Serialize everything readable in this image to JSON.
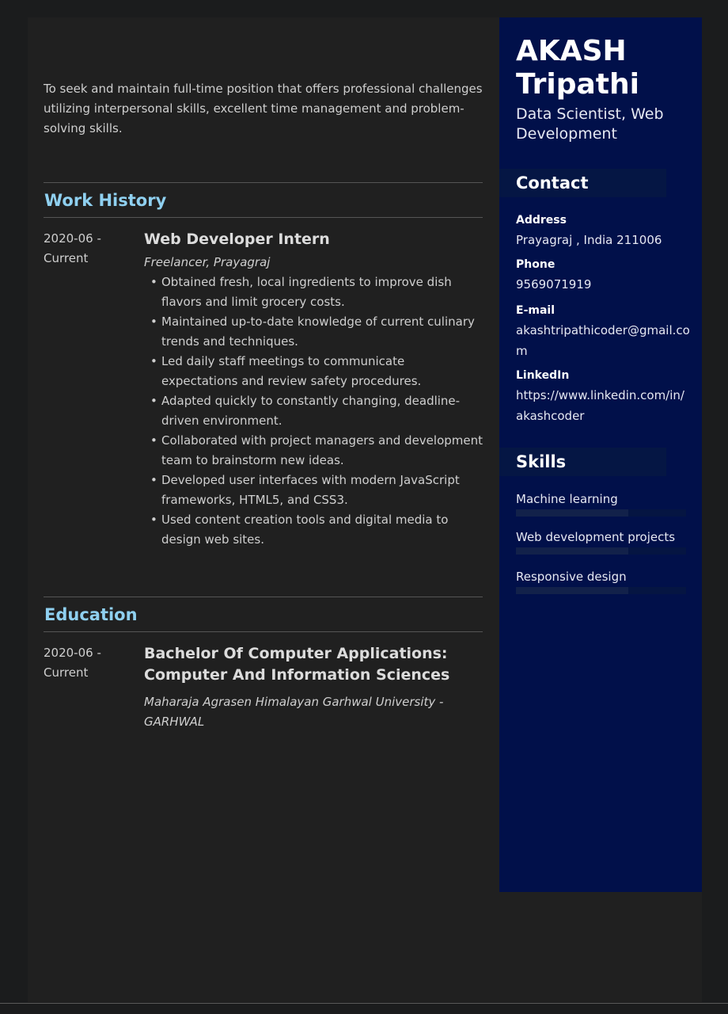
{
  "summary": "To seek and maintain full-time position that offers professional challenges utilizing interpersonal skills, excellent time management and problem-solving skills.",
  "work_history": {
    "heading": "Work History",
    "entries": [
      {
        "date_start": "2020-06 -",
        "date_end": "Current",
        "title": "Web Developer Intern",
        "company": "Freelancer, Prayagraj",
        "bullets": [
          "Obtained fresh, local ingredients to improve dish flavors and limit grocery costs.",
          "Maintained up-to-date knowledge of current culinary trends and techniques.",
          "Led daily staff meetings to communicate expectations and review safety procedures.",
          "Adapted quickly to constantly changing, deadline-driven environment.",
          "Collaborated with project managers and development team to brainstorm new ideas.",
          "Developed user interfaces with modern JavaScript frameworks, HTML5, and CSS3.",
          "Used content creation tools and digital media to design web sites."
        ]
      }
    ]
  },
  "education": {
    "heading": "Education",
    "entries": [
      {
        "date_start": "2020-06 -",
        "date_end": "Current",
        "degree": "Bachelor Of Computer Applications: Computer And Information Sciences",
        "school": "Maharaja Agrasen Himalayan Garhwal University - GARHWAL"
      }
    ]
  },
  "sidebar": {
    "name_first": "AKASH",
    "name_last": "Tripathi",
    "role": "Data Scientist, Web Development",
    "contact": {
      "heading": "Contact",
      "address_label": "Address",
      "address": "Prayagraj , India 211006",
      "phone_label": "Phone",
      "phone": "9569071919",
      "email_label": "E-mail",
      "email": "akashtripathicoder@gmail.com",
      "linkedin_label": "LinkedIn",
      "linkedin": "https://www.linkedin.com/in/akashcoder"
    },
    "skills": {
      "heading": "Skills",
      "items": [
        {
          "name": "Machine learning",
          "level": 0.66
        },
        {
          "name": "Web development projects",
          "level": 0.66
        },
        {
          "name": "Responsive design",
          "level": 0.66
        }
      ]
    }
  },
  "colors": {
    "sidebar_bg": "#01104a",
    "heading_accent": "#8fd0f0",
    "page_bg": "#202020"
  }
}
